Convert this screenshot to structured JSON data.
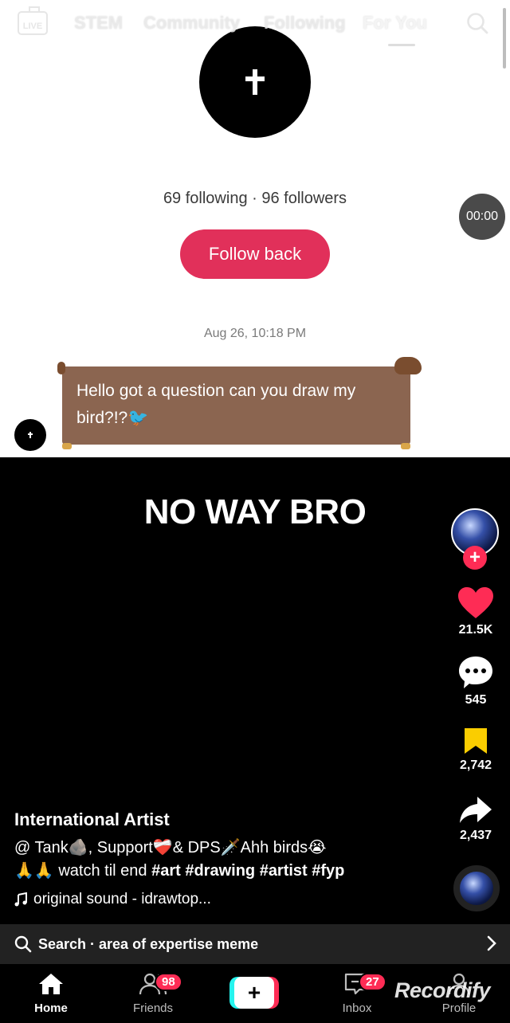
{
  "top_nav": {
    "live_label": "LIVE",
    "tabs": [
      {
        "label": "STEM"
      },
      {
        "label": "Community"
      },
      {
        "label": "Following"
      },
      {
        "label": "For You"
      }
    ]
  },
  "profile_screen": {
    "stats": "69 following · 96 followers",
    "follow_back_label": "Follow back",
    "timer": "00:00",
    "message_date": "Aug 26, 10:18 PM",
    "message_text": "Hello got a question can you draw my bird?!?🐦"
  },
  "video": {
    "title": "NO WAY BRO",
    "author": "International Artist",
    "caption_line1": "@            Tank🪨, Support❤️‍🩹& DPS🗡️Ahh birds😭",
    "caption_line2_prefix": "🙏🙏 watch til end ",
    "caption_hashtags": "#art #drawing #artist #fyp",
    "sound": "original sound - idrawtop..."
  },
  "right_rail": {
    "likes": "21.5K",
    "comments": "545",
    "saves": "2,742",
    "shares": "2,437"
  },
  "search_bar": {
    "prefix": "Search",
    "query": "area of expertise meme",
    "text": "Search · area of expertise meme"
  },
  "bottom_nav": {
    "home": "Home",
    "friends": "Friends",
    "friends_badge": "98",
    "inbox": "Inbox",
    "inbox_badge": "27",
    "profile": "Profile"
  },
  "watermark": "Recordify",
  "colors": {
    "accent_pink": "#fe2c55",
    "follow_back": "#e1305a",
    "save_yellow": "#facd00",
    "bubble_brown": "#8b6550"
  }
}
